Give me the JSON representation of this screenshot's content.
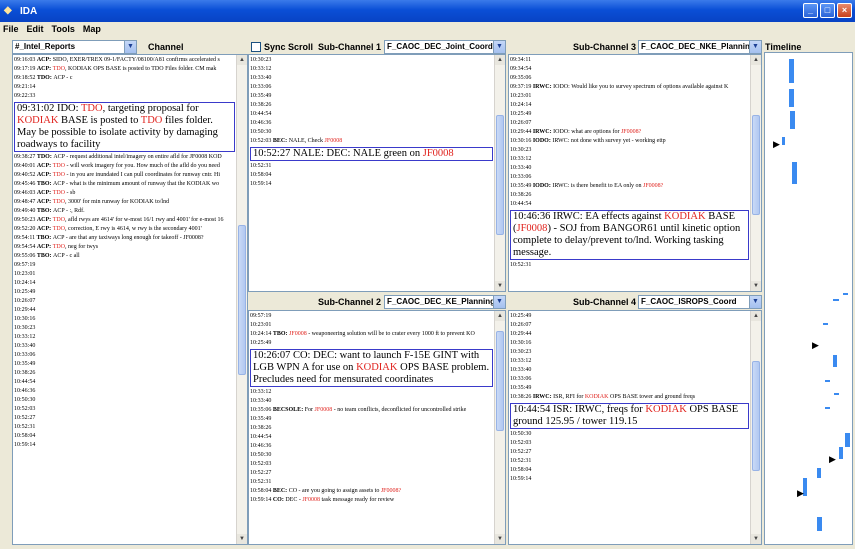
{
  "window": {
    "title": "IDA"
  },
  "menu": [
    "File",
    "Edit",
    "Tools",
    "Map"
  ],
  "main_channel": {
    "select": "#_Intel_Reports",
    "label": "Channel"
  },
  "sync_scroll": "Sync Scroll",
  "timeline_label": "Timeline",
  "sub1": {
    "label": "Sub-Channel 1",
    "select": "F_CAOC_DEC_Joint_Coord"
  },
  "sub2": {
    "label": "Sub-Channel 2",
    "select": "F_CAOC_DEC_KE_Planning"
  },
  "sub3": {
    "label": "Sub-Channel 3",
    "select": "F_CAOC_DEC_NKE_Planning"
  },
  "sub4": {
    "label": "Sub-Channel 4",
    "select": "F_CAOC_ISROPS_Coord"
  },
  "main_msgs": [
    {
      "t": "09:16:03 ",
      "s": "ACP: ",
      "m": "SIDO, EXER/TREX 09-1/FACTY/08100/A81 confirms accelerated s"
    },
    {
      "t": "09:17:19 ",
      "s": "ACP: ",
      "r": "TDO",
      "m": ", KODIAK OPS BASE is posted to TDO Files folder.  CM mak"
    },
    {
      "t": "09:18:52 ",
      "s": "TDO: ",
      "m": "ACP - c"
    },
    {
      "t": "09:21:14",
      "m": ""
    },
    {
      "t": "09:22:33",
      "m": ""
    },
    {
      "big": true,
      "text": "09:31:02 IDO: TDO, targeting proposal for KODIAK BASE is posted to TDO files folder.  May be possible to isolate activity by damaging roadways to facility"
    },
    {
      "t": "09:38:27 ",
      "s": "TDO: ",
      "m": "ACP - request additional intel/imagery on entire afld for JF0008 KOD"
    },
    {
      "t": "09:40:01 ",
      "s": "ACP: ",
      "r": "TDO",
      "m": " - will work imagery for you. How much of the afld do you need"
    },
    {
      "t": "09:40:52 ",
      "s": "ACP: ",
      "r": "TDO",
      "m": " - in you are inundated I can pull coordinates for runway cntr. Hi"
    },
    {
      "t": "09:45:46 ",
      "s": "TBO: ",
      "m": "ACP - what is the minimum amount of runway that the KODIAK wo"
    },
    {
      "t": "09:46:03 ",
      "s": "ACP: ",
      "r": "TDO",
      "m": " - sb"
    },
    {
      "t": "09:48:47 ",
      "s": "ACP: ",
      "r": "TDO",
      "m": ", 3000' for min runway for KODIAK to/lnd"
    },
    {
      "t": "09:49:40 ",
      "s": "TBO: ",
      "m": "ACP - :, Rdf."
    },
    {
      "t": "09:50:23 ",
      "s": "ACP: ",
      "r": "TDO",
      "m": ", afld rwys are 4614' for w-most 16/1 rwy and 4001' for e-most 16"
    },
    {
      "t": "09:52:20 ",
      "s": "ACP: ",
      "r": "TDO",
      "m": ", correction, E rwy is 4614, w rwy is the secondary 4001'"
    },
    {
      "t": "09:54:11 ",
      "s": "TBO: ",
      "m": "ACP - are that any taxiways long enough for takeoff - JF0008?"
    },
    {
      "t": "09:54:54 ",
      "s": "ACP: ",
      "r": "TDO",
      "m": ", neg for twys"
    },
    {
      "t": "09:55:06 ",
      "s": "TBO: ",
      "m": "ACP - c all"
    },
    {
      "t": "09:57:19",
      "m": ""
    },
    {
      "t": "10:23:01",
      "m": ""
    },
    {
      "t": "10:24:14",
      "m": ""
    },
    {
      "t": "10:25:49",
      "m": ""
    },
    {
      "t": "10:26:07",
      "m": ""
    },
    {
      "t": "10:29:44",
      "m": ""
    },
    {
      "t": "10:30:16",
      "m": ""
    },
    {
      "t": "10:30:23",
      "m": ""
    },
    {
      "t": "10:33:12",
      "m": ""
    },
    {
      "t": "10:33:40",
      "m": ""
    },
    {
      "t": "10:33:06",
      "m": ""
    },
    {
      "t": "10:35:49",
      "m": ""
    },
    {
      "t": "10:38:26",
      "m": ""
    },
    {
      "t": "10:44:54",
      "m": ""
    },
    {
      "t": "10:46:36",
      "m": ""
    },
    {
      "t": "10:50:30",
      "m": ""
    },
    {
      "t": "10:52:03",
      "m": ""
    },
    {
      "t": "10:52:27",
      "m": ""
    },
    {
      "t": "10:52:31",
      "m": ""
    },
    {
      "t": "10:58:04",
      "m": ""
    },
    {
      "t": "10:59:14",
      "m": ""
    }
  ],
  "sub1_msgs": [
    {
      "t": "10:30:23",
      "m": ""
    },
    {
      "t": "10:33:12",
      "m": ""
    },
    {
      "t": "10:33:40",
      "m": ""
    },
    {
      "t": "10:33:06",
      "m": ""
    },
    {
      "t": "10:35:49",
      "m": ""
    },
    {
      "t": "10:38:26",
      "m": ""
    },
    {
      "t": "10:44:54",
      "m": ""
    },
    {
      "t": "10:46:36",
      "m": ""
    },
    {
      "t": "10:50:30",
      "m": ""
    },
    {
      "t": "10:52:03 ",
      "s": "BEC: ",
      "m": "NALE, Check ",
      "r2": "JF0008"
    },
    {
      "big": true,
      "text": "10:52:27 NALE: DEC: NALE green on JF0008"
    },
    {
      "t": "10:52:31",
      "m": ""
    },
    {
      "t": "10:58:04",
      "m": ""
    },
    {
      "t": "10:59:14",
      "m": ""
    }
  ],
  "sub2_msgs": [
    {
      "t": "09:57:19",
      "m": ""
    },
    {
      "t": "10:23:01",
      "m": ""
    },
    {
      "t": "10:24:14 ",
      "s": "TBO: ",
      "r": "JF0008",
      "m": " - weaponeering solution will be to crater every 1000 ft to prevent KO"
    },
    {
      "t": "10:25:49",
      "m": ""
    },
    {
      "big": true,
      "text": "10:26:07 CO: DEC: want to launch F-15E GINT with LGB WPN A for use on KODIAK OPS BASE problem.  Precludes need for mensurated coordinates"
    },
    {
      "t": "10:33:12",
      "m": ""
    },
    {
      "t": "10:33:40",
      "m": ""
    },
    {
      "t": "10:35:06 ",
      "s": "BECSOLE: ",
      "m": "For ",
      "r2": "JF0008",
      "m2": " - no team conflicts, deconflicted for uncontrolled strike"
    },
    {
      "t": "10:35:49",
      "m": ""
    },
    {
      "t": "10:38:26",
      "m": ""
    },
    {
      "t": "10:44:54",
      "m": ""
    },
    {
      "t": "10:46:36",
      "m": ""
    },
    {
      "t": "10:50:30",
      "m": ""
    },
    {
      "t": "10:52:03",
      "m": ""
    },
    {
      "t": "10:52:27",
      "m": ""
    },
    {
      "t": "10:52:31",
      "m": ""
    },
    {
      "t": "10:58:04 ",
      "s": "BEC: ",
      "m": "CO - are you going to assign assets to ",
      "r2": "JF0008?"
    },
    {
      "t": "10:59:14 ",
      "s": "CO: ",
      "m": "DEC - ",
      "r2": "JF0008",
      "m2": " task message ready for review"
    }
  ],
  "sub3_msgs": [
    {
      "t": "09:34:11",
      "m": ""
    },
    {
      "t": "09:34:54",
      "m": ""
    },
    {
      "t": "09:35:06",
      "m": ""
    },
    {
      "t": "09:37:19 ",
      "s": "IRWC: ",
      "m": "IODO: Would like you to survey spectrum of options available against K"
    },
    {
      "t": "10:23:01",
      "m": ""
    },
    {
      "t": "10:24:14",
      "m": ""
    },
    {
      "t": "10:25:49",
      "m": ""
    },
    {
      "t": "10:26:07",
      "m": ""
    },
    {
      "t": "10:29:44 ",
      "s": "IRWC: ",
      "m": "IODO: what are options for ",
      "r2": "JF0008?"
    },
    {
      "t": "10:30:16 ",
      "s": "IODO: ",
      "m": "IRWC: not done with survey yet - working ettp"
    },
    {
      "t": "10:30:23",
      "m": ""
    },
    {
      "t": "10:33:12",
      "m": ""
    },
    {
      "t": "10:33:40",
      "m": ""
    },
    {
      "t": "10:33:06",
      "m": ""
    },
    {
      "t": "10:35:49 ",
      "s": "IODO: ",
      "m": "IRWC: is there benefit to EA only on ",
      "r2": "JF0008?"
    },
    {
      "t": "10:38:26",
      "m": ""
    },
    {
      "t": "10:44:54",
      "m": ""
    },
    {
      "big": true,
      "text": "10:46:36 IRWC: EA effects against KODIAK BASE (JF0008) - SOJ from BANGOR61 until kinetic option complete to delay/prevent to/lnd.  Working tasking message."
    },
    {
      "t": "10:52:31",
      "m": ""
    }
  ],
  "sub4_msgs": [
    {
      "t": "10:25:49",
      "m": ""
    },
    {
      "t": "10:26:07",
      "m": ""
    },
    {
      "t": "10:29:44",
      "m": ""
    },
    {
      "t": "10:30:16",
      "m": ""
    },
    {
      "t": "10:30:23",
      "m": ""
    },
    {
      "t": "10:33:12",
      "m": ""
    },
    {
      "t": "10:33:40",
      "m": ""
    },
    {
      "t": "10:33:06",
      "m": ""
    },
    {
      "t": "10:35:49",
      "m": ""
    },
    {
      "t": "10:38:26 ",
      "s": "IRWC: ",
      "m": "ISR, RFI for ",
      "r2": "KODIAK",
      "m2": " OPS BASE tower and ground freqs"
    },
    {
      "big": true,
      "text": "10:44:54 ISR: IRWC, freqs for KODIAK OPS BASE ground 125.95 / tower 119.15"
    },
    {
      "t": "10:50:30",
      "m": ""
    },
    {
      "t": "10:52:03",
      "m": ""
    },
    {
      "t": "10:52:27",
      "m": ""
    },
    {
      "t": "10:52:31",
      "m": ""
    },
    {
      "t": "10:58:04",
      "m": ""
    },
    {
      "t": "10:59:14",
      "m": ""
    }
  ],
  "colors": {
    "highlight": "#e0231e",
    "timeline_bar": "#3a8af0",
    "titlebar": "#0a4fd6"
  }
}
